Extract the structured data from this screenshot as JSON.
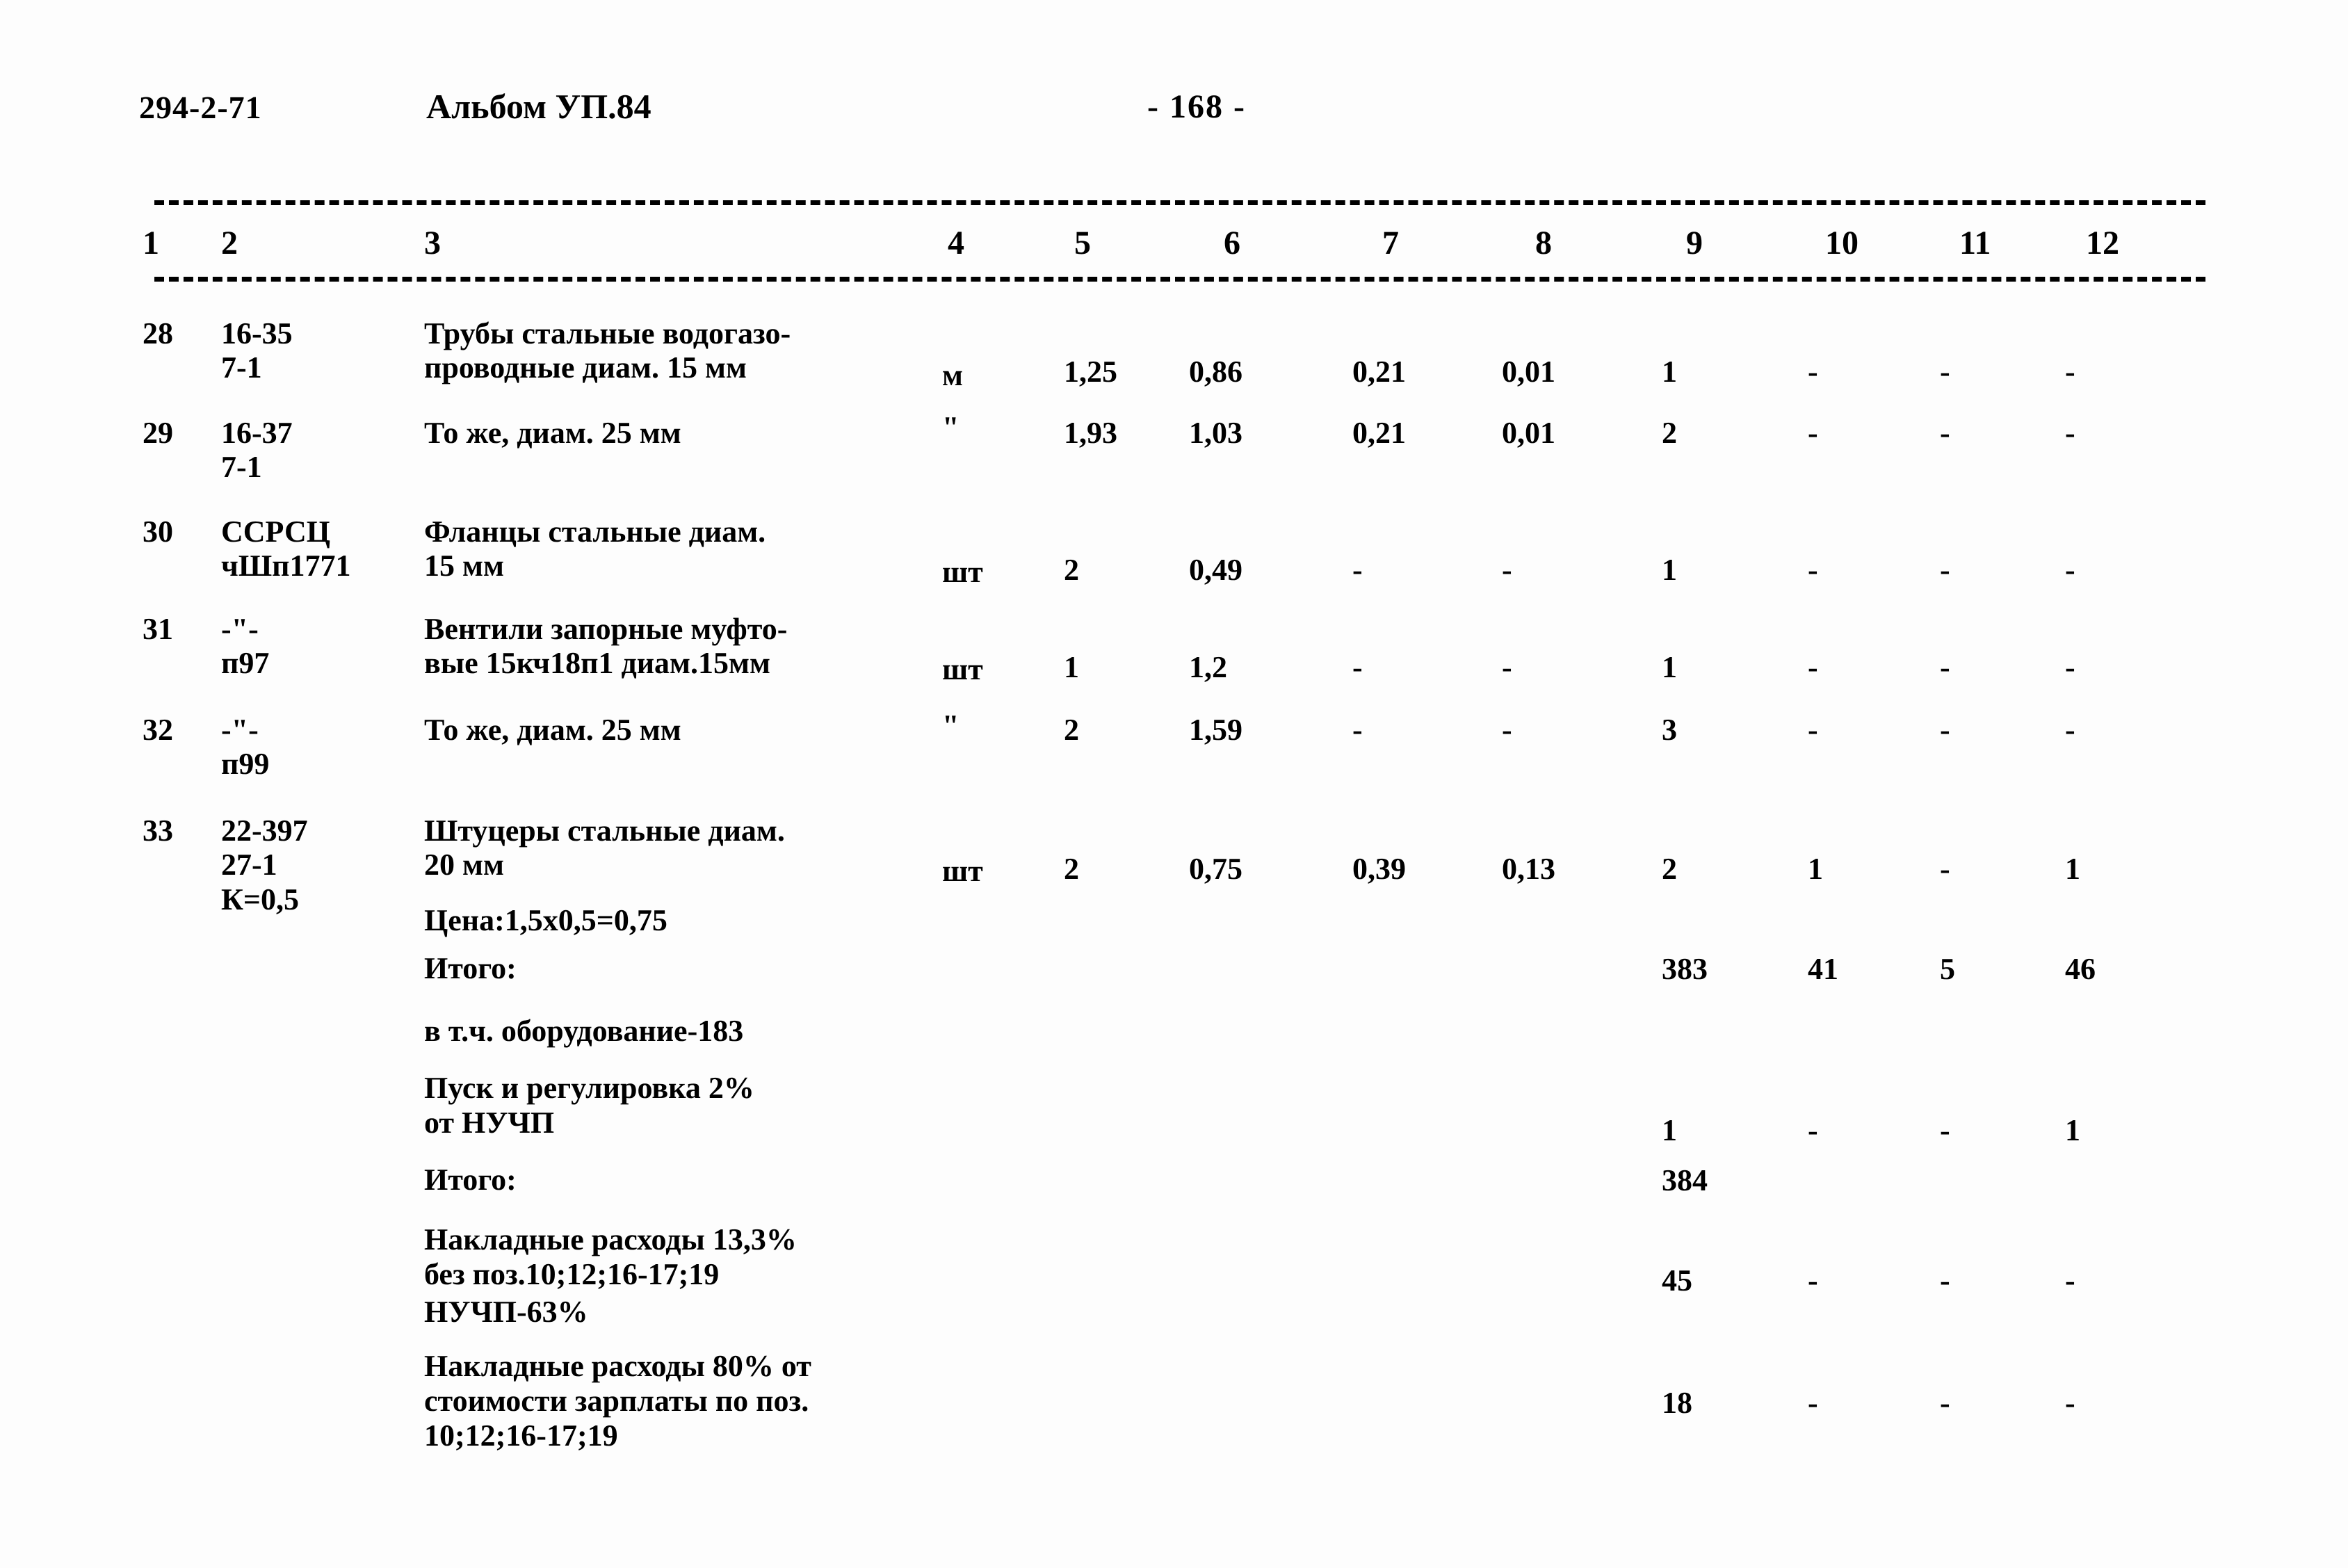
{
  "header": {
    "doc_code": "294-2-71",
    "album": "Альбом УП.84",
    "page_marker": "- 168 -"
  },
  "table": {
    "column_numbers": [
      "1",
      "2",
      "3",
      "4",
      "5",
      "6",
      "7",
      "8",
      "9",
      "10",
      "11",
      "12"
    ],
    "rows": [
      {
        "c1": "28",
        "c2": "16-35\n7-1",
        "c3": "Трубы стальные водогазо-\nпроводные диам. 15 мм",
        "c4": "м",
        "c5": "1,25",
        "c6": "0,86",
        "c7": "0,21",
        "c8": "0,01",
        "c9": "1",
        "c10": "-",
        "c11": "-",
        "c12": "-"
      },
      {
        "c1": "29",
        "c2": "16-37\n7-1",
        "c3": "То же, диам. 25 мм",
        "c4": "\"",
        "c5": "1,93",
        "c6": "1,03",
        "c7": "0,21",
        "c8": "0,01",
        "c9": "2",
        "c10": "-",
        "c11": "-",
        "c12": "-"
      },
      {
        "c1": "30",
        "c2": "ССРСЦ\nчШп1771",
        "c3": "Фланцы стальные диам.\n15 мм",
        "c4": "шт",
        "c5": "2",
        "c6": "0,49",
        "c7": "-",
        "c8": "-",
        "c9": "1",
        "c10": "-",
        "c11": "-",
        "c12": "-"
      },
      {
        "c1": "31",
        "c2": "-\"-\nп97",
        "c3": "Вентили запорные муфто-\nвые 15кч18п1 диам.15мм",
        "c4": "шт",
        "c5": "1",
        "c6": "1,2",
        "c7": "-",
        "c8": "-",
        "c9": "1",
        "c10": "-",
        "c11": "-",
        "c12": "-"
      },
      {
        "c1": "32",
        "c2": "-\"-\nп99",
        "c3": "То же, диам. 25 мм",
        "c4": "\"",
        "c5": "2",
        "c6": "1,59",
        "c7": "-",
        "c8": "-",
        "c9": "3",
        "c10": "-",
        "c11": "-",
        "c12": "-"
      },
      {
        "c1": "33",
        "c2": "22-397\n27-1\nК=0,5",
        "c3": "Штуцеры стальные диам.\n20 мм",
        "c3_note": "Цена:1,5х0,5=0,75",
        "c4": "шт",
        "c5": "2",
        "c6": "0,75",
        "c7": "0,39",
        "c8": "0,13",
        "c9": "2",
        "c10": "1",
        "c11": "-",
        "c12": "1"
      }
    ]
  },
  "summary": [
    {
      "label": "Итого:",
      "c9": "383",
      "c10": "41",
      "c11": "5",
      "c12": "46"
    },
    {
      "label": "в т.ч. оборудование-183",
      "c9": "",
      "c10": "",
      "c11": "",
      "c12": ""
    },
    {
      "label": "Пуск и регулировка 2%\nот НУЧП",
      "c9": "1",
      "c10": "-",
      "c11": "-",
      "c12": "1"
    },
    {
      "label": "Итого:",
      "c9": "384",
      "c10": "",
      "c11": "",
      "c12": ""
    },
    {
      "label": "Накладные расходы 13,3%\nбез поз.10;12;16-17;19",
      "c9": "45",
      "c10": "-",
      "c11": "-",
      "c12": "-"
    },
    {
      "label": "НУЧП-63%",
      "c9": "",
      "c10": "",
      "c11": "",
      "c12": ""
    },
    {
      "label": "Накладные расходы 80% от\nстоимости зарплаты по поз.\n10;12;16-17;19",
      "c9": "18",
      "c10": "-",
      "c11": "-",
      "c12": "-"
    }
  ]
}
